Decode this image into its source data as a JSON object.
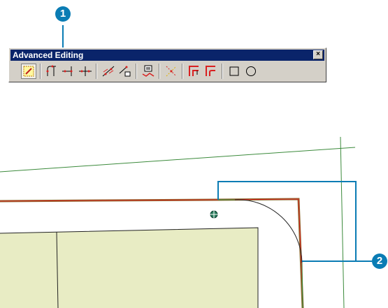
{
  "callouts": {
    "one": "1",
    "two": "2"
  },
  "toolbar": {
    "title": "Advanced Editing",
    "close_symbol": "×",
    "tools": [
      {
        "name": "edit-tool-icon"
      },
      {
        "name": "fillet-tool-icon"
      },
      {
        "name": "extend-tool-icon"
      },
      {
        "name": "trim-tool-icon"
      },
      {
        "name": "line-intersection-icon"
      },
      {
        "name": "explode-multipart-icon"
      },
      {
        "name": "generalize-icon"
      },
      {
        "name": "smooth-icon"
      },
      {
        "name": "copy-parallel-icon"
      },
      {
        "name": "align-to-shape-icon"
      },
      {
        "name": "rectangle-icon"
      },
      {
        "name": "circle-icon"
      }
    ]
  },
  "map": {
    "colors": {
      "parcel_fill": "#e8ecc4",
      "boundary": "#8b6a2e",
      "selected": "#d92020",
      "thin_lines": "#3b8a3b",
      "fillet_arc": "#222222"
    }
  }
}
